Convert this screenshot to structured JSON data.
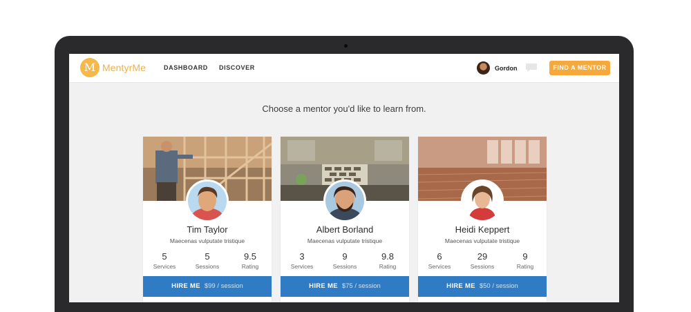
{
  "app": {
    "logo_letter": "M",
    "logo_text": "MentyrMe"
  },
  "nav": {
    "items": [
      {
        "label": "DASHBOARD"
      },
      {
        "label": "DISCOVER"
      }
    ]
  },
  "user": {
    "name": "Gordon",
    "avatar_icon": "user-avatar",
    "chat_icon": "chat-bubble-icon"
  },
  "cta": {
    "label": "FIND A MENTOR"
  },
  "headline": "Choose a mentor you'd like to learn from.",
  "colors": {
    "accent": "#f7a83a",
    "hire_blue": "#2f7bc4",
    "bezel": "#2a2a2c",
    "background": "#f1f1f1"
  },
  "mentors": [
    {
      "name": "Tim Taylor",
      "description": "Maecenas vulputate tristique",
      "stats": [
        {
          "value": "5",
          "label": "Services"
        },
        {
          "value": "5",
          "label": "Sessions"
        },
        {
          "value": "9.5",
          "label": "Rating"
        }
      ],
      "hire_label": "HIRE ME",
      "price": "$99 / session"
    },
    {
      "name": "Albert Borland",
      "description": "Maecenas vulputate tristique",
      "stats": [
        {
          "value": "3",
          "label": "Services"
        },
        {
          "value": "9",
          "label": "Sessions"
        },
        {
          "value": "9.8",
          "label": "Rating"
        }
      ],
      "hire_label": "HIRE ME",
      "price": "$75 / session"
    },
    {
      "name": "Heidi Keppert",
      "description": "Maecenas vulputate tristique",
      "stats": [
        {
          "value": "6",
          "label": "Services"
        },
        {
          "value": "29",
          "label": "Sessions"
        },
        {
          "value": "9",
          "label": "Rating"
        }
      ],
      "hire_label": "HIRE ME",
      "price": "$50 / session"
    }
  ]
}
